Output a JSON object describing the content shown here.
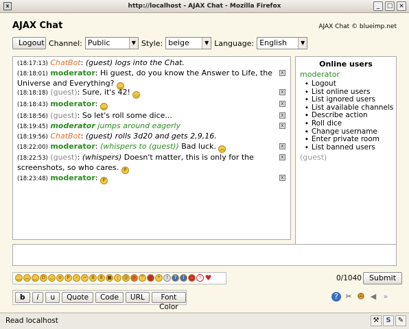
{
  "window": {
    "title": "http://localhost - AJAX Chat - Mozilla Firefox"
  },
  "app": {
    "title": "AJAX Chat",
    "copyright": "AJAX Chat © blueimp.net"
  },
  "controls": {
    "logout": "Logout",
    "channel_label": "Channel:",
    "channel_value": "Public",
    "style_label": "Style:",
    "style_value": "beige",
    "language_label": "Language:",
    "language_value": "English"
  },
  "messages": [
    {
      "time": "(18:17:13)",
      "user": "ChatBot",
      "sep": ":",
      "text": "(guest) logs into the Chat.",
      "kind": "bot"
    },
    {
      "time": "(18:18:01)",
      "user": "moderator",
      "sep": ":",
      "text": "Hi guest, do you know the Answer to Life, the",
      "text2": "Universe and Everything?",
      "kind": "mod"
    },
    {
      "time": "(18:18:18)",
      "user": "(guest)",
      "sep": ":",
      "text": "Sure, it's 42!",
      "kind": "guest"
    },
    {
      "time": "(18:18:43)",
      "user": "moderator",
      "sep": ":",
      "text": "",
      "kind": "mod"
    },
    {
      "time": "(18:18:56)",
      "user": "(guest)",
      "sep": ":",
      "text": "So let's roll some dice...",
      "kind": "guest"
    },
    {
      "time": "(18:19:45)",
      "user": "moderator",
      "sep": "",
      "text": "jumps around eagerly",
      "kind": "mod-action"
    },
    {
      "time": "(18:19:56)",
      "user": "ChatBot",
      "sep": ":",
      "text": "(guest) rolls 3d20 and gets 2,9,16.",
      "kind": "bot"
    },
    {
      "time": "(18:22:00)",
      "user": "moderator",
      "sep": ":",
      "text": "(whispers to (guest))",
      "text2": "Bad luck.",
      "kind": "mod-whisper"
    },
    {
      "time": "(18:22:53)",
      "user": "(guest)",
      "sep": ":",
      "text": "(whispers)",
      "text2": "Doesn't matter, this is only for the",
      "text3": "screenshots, so who cares.",
      "kind": "guest-whisper"
    },
    {
      "time": "(18:23:48)",
      "user": "moderator",
      "sep": ":",
      "text": "",
      "kind": "mod"
    }
  ],
  "online": {
    "title": "Online users",
    "moderator": "moderator",
    "menu": [
      "Logout",
      "List online users",
      "List ignored users",
      "List available channels",
      "Describe action",
      "Roll dice",
      "Change username",
      "Enter private room",
      "List banned users"
    ],
    "guest": "(guest)"
  },
  "input": {
    "counter": "0/1040",
    "submit": "Submit"
  },
  "format": {
    "bold": "b",
    "italic": "i",
    "underline": "u",
    "quote": "Quote",
    "code": "Code",
    "url": "URL",
    "font_color": "Font Color"
  },
  "status": {
    "text": "Read localhost"
  }
}
